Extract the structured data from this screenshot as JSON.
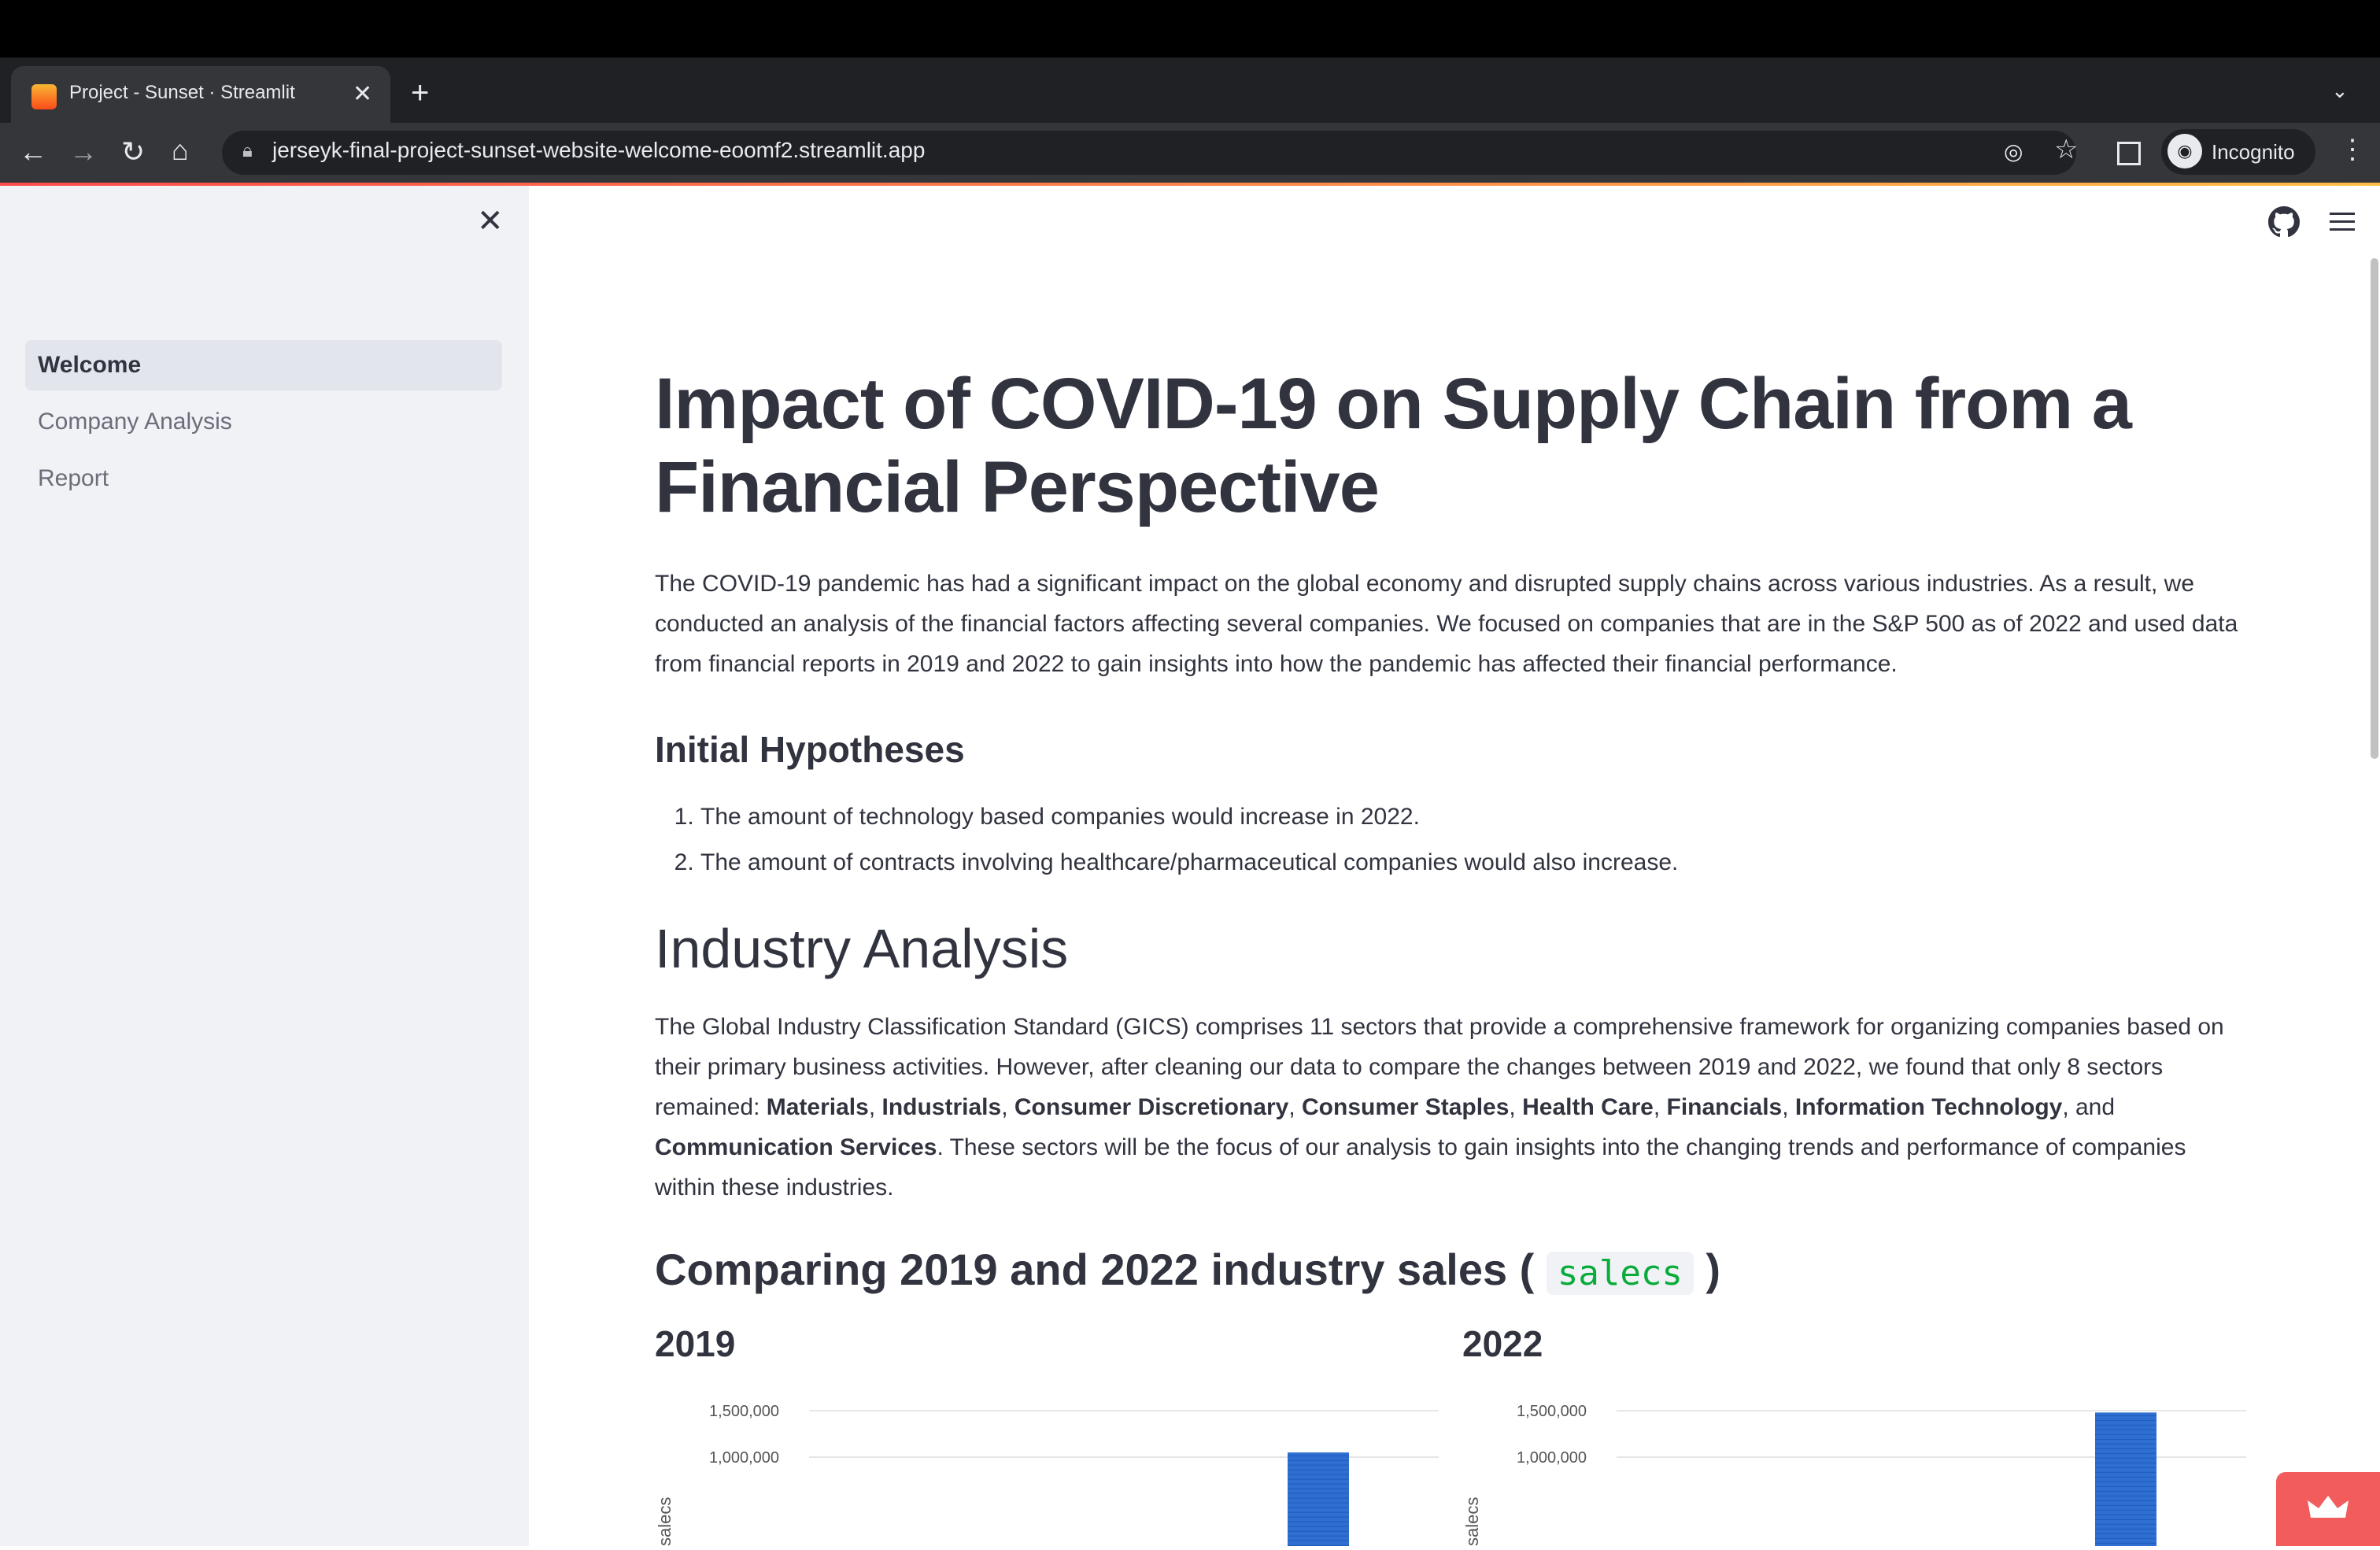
{
  "browser": {
    "tab_title": "Project - Sunset · Streamlit",
    "url": "jerseyk-final-project-sunset-website-welcome-eoomf2.streamlit.app",
    "profile_label": "Incognito"
  },
  "sidebar": {
    "items": [
      {
        "label": "Welcome",
        "active": true
      },
      {
        "label": "Company Analysis",
        "active": false
      },
      {
        "label": "Report",
        "active": false
      }
    ]
  },
  "main": {
    "title": "Impact of COVID-19 on Supply Chain from a Financial Perspective",
    "intro": "The COVID-19 pandemic has had a significant impact on the global economy and disrupted supply chains across various industries. As a result, we conducted an analysis of the financial factors affecting several companies. We focused on companies that are in the S&P 500 as of 2022 and used data from financial reports in 2019 and 2022 to gain insights into how the pandemic has affected their financial performance.",
    "hypotheses_heading": "Initial Hypotheses",
    "hypotheses": [
      "The amount of technology based companies would increase in 2022.",
      "The amount of contracts involving healthcare/pharmaceutical companies would also increase."
    ],
    "industry_heading": "Industry Analysis",
    "industry_text_1": "The Global Industry Classification Standard (GICS) comprises 11 sectors that provide a comprehensive framework for organizing companies based on their primary business activities. However, after cleaning our data to compare the changes between 2019 and 2022, we found that only 8 sectors remained: ",
    "sectors": [
      "Materials",
      "Industrials",
      "Consumer Discretionary",
      "Consumer Staples",
      "Health Care",
      "Financials",
      "Information Technology",
      "Communication Services"
    ],
    "industry_text_2": ". These sectors will be the focus of our analysis to gain insights into the changing trends and performance of companies within these industries.",
    "comparing_heading_pre": "Comparing 2019 and 2022 industry sales (",
    "comparing_code": "salecs",
    "comparing_heading_post": ")"
  },
  "chart_data": [
    {
      "type": "bar",
      "title": "2019",
      "ylabel": "salecs",
      "yticks": [
        "1,500,000",
        "1,000,000"
      ],
      "ylim": [
        0,
        1500000
      ],
      "visible_bar_value": 1050000,
      "color": "#2e6fd1"
    },
    {
      "type": "bar",
      "title": "2022",
      "ylabel": "salecs",
      "yticks": [
        "1,500,000",
        "1,000,000"
      ],
      "ylim": [
        0,
        1500000
      ],
      "visible_bar_value": 1480000,
      "color": "#2e6fd1"
    }
  ]
}
